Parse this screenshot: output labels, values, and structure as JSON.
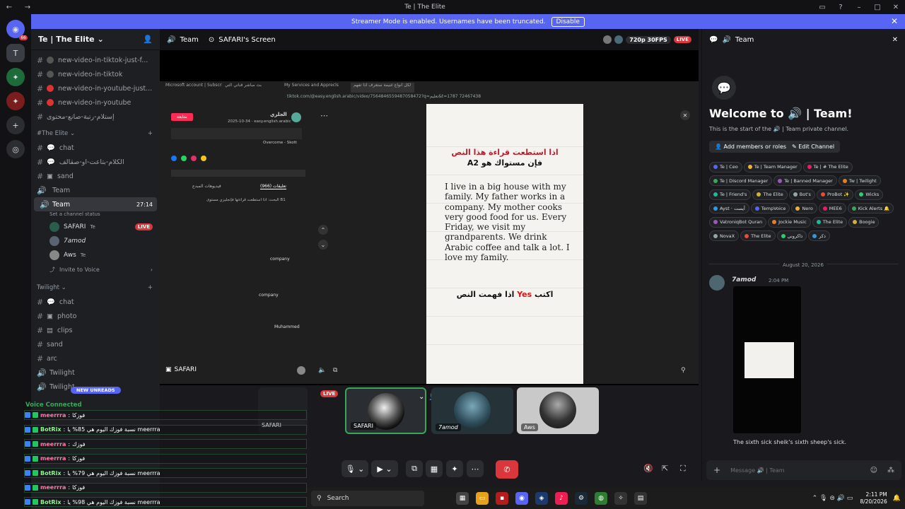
{
  "window": {
    "title": "Te | The Elite"
  },
  "banner": {
    "text": "Streamer Mode is enabled. Usernames have been truncated.",
    "button": "Disable"
  },
  "rail": {
    "badge": "66"
  },
  "sidebar": {
    "guild": "Te | The Elite",
    "top_channels": [
      "new-video-in-tiktok-just-f...",
      "new-video-in-tiktok",
      "new-video-in-youtube-just...",
      "new-video-in-youtube",
      "إستلام-رتبة-صانع-محتوى"
    ],
    "category1": "#The Elite",
    "cat1_channels": [
      "chat",
      "الكلام-بتاعت-او-صقالف",
      "sand",
      "Team"
    ],
    "active_channel": {
      "name": "Team",
      "time": "27:14",
      "status": "Set a channel status"
    },
    "members": [
      {
        "name": "SAFARI",
        "tag": "Te",
        "live": "LIVE"
      },
      {
        "name": "7amod",
        "tag": ""
      },
      {
        "name": "Aws",
        "tag": "Te"
      }
    ],
    "invite": "Invite to Voice",
    "category2": "Twilight",
    "cat2_channels": [
      "chat",
      "photo",
      "clips",
      "sand",
      "arc",
      "Twilight",
      "Twilight"
    ],
    "new_unreads": "NEW UNREADS",
    "voice_connected": "Voice Connected"
  },
  "stream_header": {
    "channel": "Team",
    "screen": "SAFARI's Screen",
    "quality": "720p 30FPS",
    "live": "LIVE"
  },
  "browser": {
    "tabs": [
      "Microsoft account | Subscriptions",
      "بث مباشر قناتي التي",
      "My Services and Apprecls",
      "لكل أنواع غنيمة ستعرف اذا تفهم"
    ],
    "url": "tiktok.com/@easy.english.arabic/video/7564846559487058472?q=تعليم&t=1787 72467438"
  },
  "tiktok": {
    "follow": "متابعة",
    "author": "الجلزي",
    "date": "2025-10-34 · easy.english.arabic",
    "sound": "Overcome - Skott",
    "tabs": [
      "(966) تعليقات",
      "فيديوهات المبدع"
    ],
    "comments_header": "البحث: اذا استطعت قراءتها فإنجليزي مستوى B1",
    "comment_items": [
      "company",
      "company",
      "Muhammed"
    ],
    "input_user": "SAFARI"
  },
  "video": {
    "ar_title_1": "اذا استطعت قراءة هذا النص",
    "ar_title_2": "فإن مستواك هو A2",
    "en_text": "I live in a big house with my family. My father works in a company. My mother cooks very good food for us. Every Friday, we visit my grandparents. We drink Arabic coffee and talk a lot. I love my family.",
    "ar_bottom_1": "اكتب",
    "ar_bottom_yes": "Yes",
    "ar_bottom_2": "اذا فهمت النص"
  },
  "tiles": [
    {
      "name": "SAFARI",
      "live": "LIVE"
    },
    {
      "name": "7amod"
    },
    {
      "name": "Aws"
    }
  ],
  "chat": {
    "header": "Team",
    "welcome": "Welcome to 🔊 | Team!",
    "start": "This is the start of the 🔊 | Team private channel.",
    "add_members": "Add members or roles",
    "edit_channel": "Edit Channel",
    "roles": [
      "Te | Ceo",
      "Te | Team Manager",
      "Te | # The Elite",
      "Te | Discord Manager",
      "Te | Banned Manager",
      "Tw | Twilight",
      "Te | Friend's",
      "The Elite",
      "Bot's",
      "ProBot ✨",
      "Wicks",
      "Ayst · أيست",
      "TempVoice",
      "Nero",
      "MEE6",
      "Kick Alerts 🔔",
      "VatroniqBot Quran",
      "Jockie Music",
      "The Elite",
      "Boogie",
      "NovaX",
      "The Elite",
      "ذاكروني",
      "ذكر"
    ],
    "date_divider": "August 20, 2026",
    "msg_author": "7amod",
    "msg_time": "2:04 PM",
    "tongue_twister": "The sixth sick sheik's sixth sheep's sick.",
    "placeholder": "Message 🔊 | Team"
  },
  "overlay": {
    "messages": [
      {
        "user": "meerrra",
        "text": "فوزكا"
      },
      {
        "user": "BotRix",
        "text": "نسبة فوزك اليوم هي 85% يا meerrra"
      },
      {
        "user": "meerrra",
        "text": "فوزك"
      },
      {
        "user": "meerrra",
        "text": "فوزكا"
      },
      {
        "user": "BotRix",
        "text": "نسبة فوزك اليوم هي 79% يا meerrra"
      },
      {
        "user": "meerrra",
        "text": "فوزكا"
      },
      {
        "user": "BotRix",
        "text": "نسبة فوزك اليوم هي 98% يا meerrra"
      }
    ],
    "safari_label": "SAFARI"
  },
  "taskbar": {
    "search": "Search",
    "time": "2:11 PM",
    "date": "8/20/2026"
  }
}
